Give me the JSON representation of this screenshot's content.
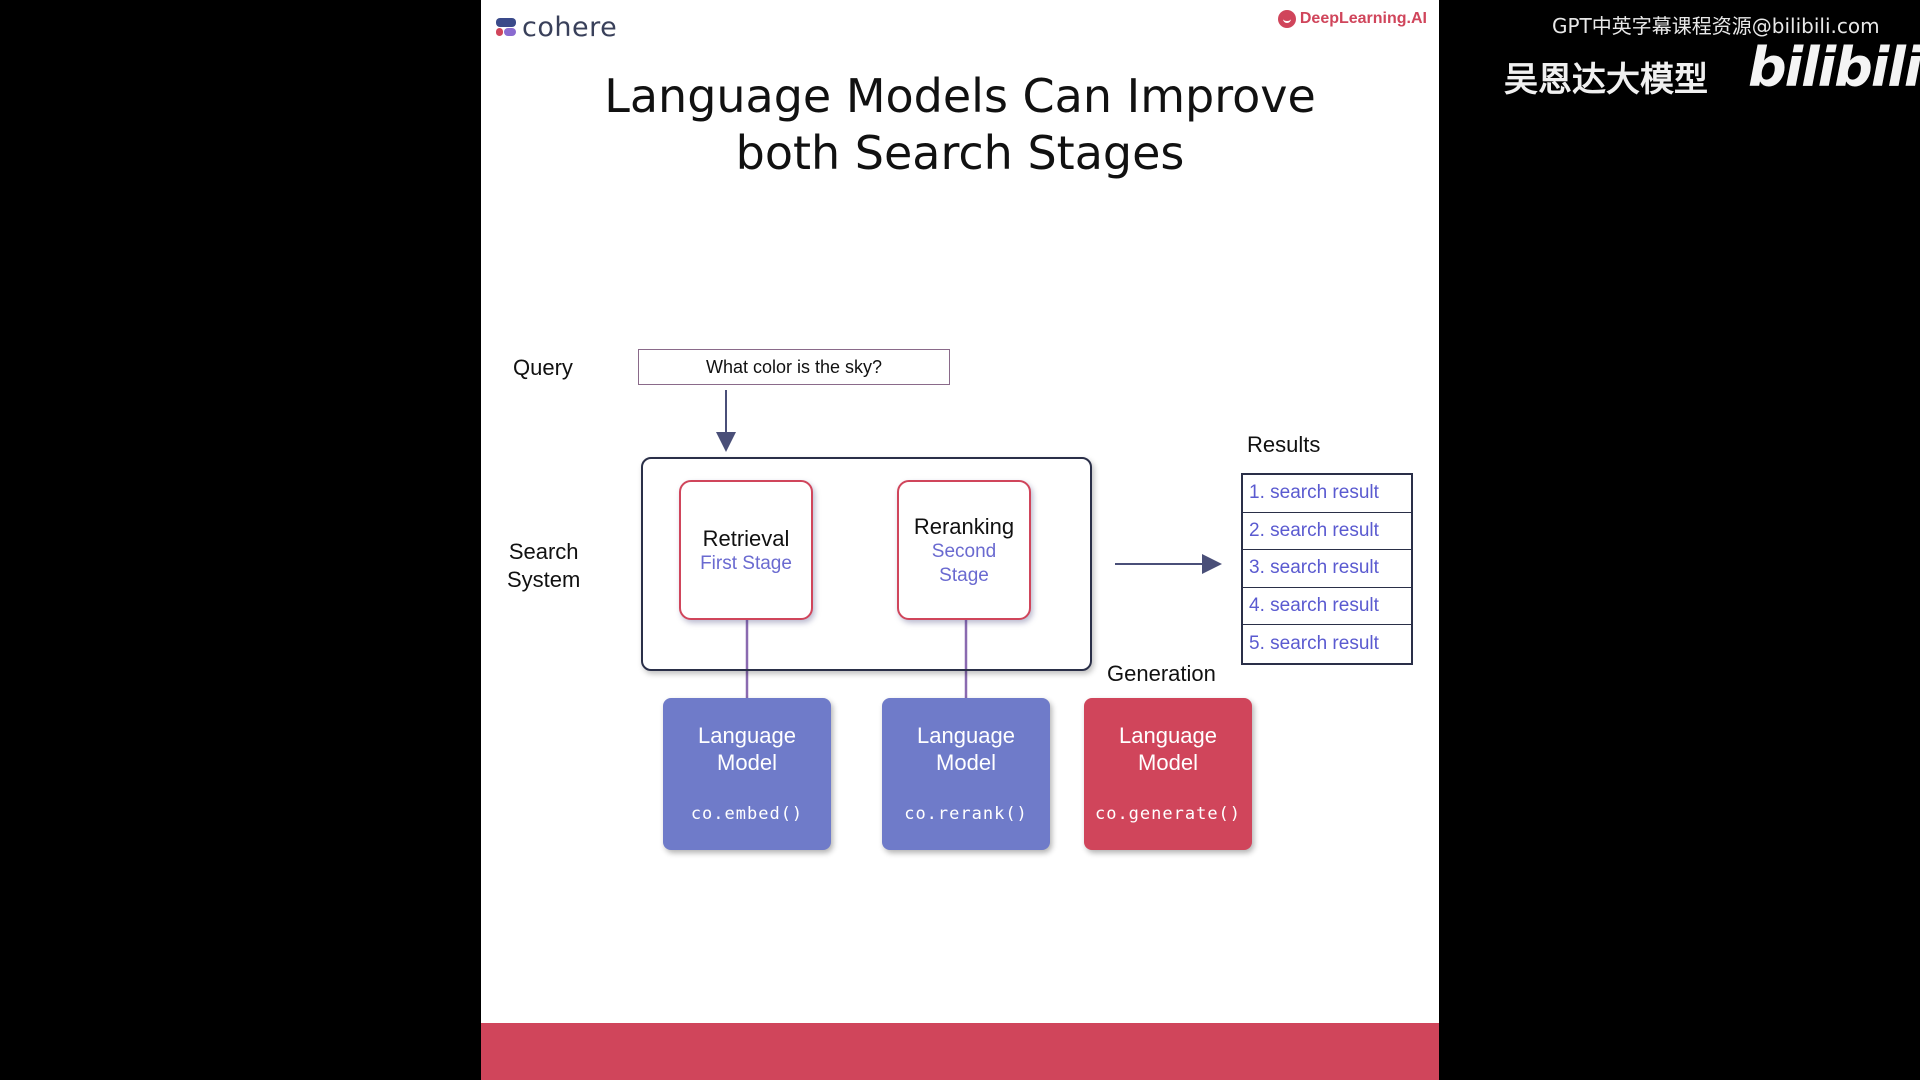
{
  "slide": {
    "brand_left": "cohere",
    "brand_right": "DeepLearning.AI",
    "title_line1": "Language Models Can Improve",
    "title_line2": "both Search Stages"
  },
  "diagram": {
    "query_label": "Query",
    "query_text": "What color is the sky?",
    "search_system_line1": "Search",
    "search_system_line2": "System",
    "retrieval": {
      "name": "Retrieval",
      "stage": "First Stage"
    },
    "reranking": {
      "name": "Reranking",
      "stage_line1": "Second",
      "stage_line2": "Stage"
    },
    "results_label": "Results",
    "results": [
      "1. search result",
      "2. search result",
      "3. search result",
      "4. search result",
      "5. search result"
    ],
    "generation_label": "Generation",
    "models": [
      {
        "line1": "Language",
        "line2": "Model",
        "code": "co.embed()"
      },
      {
        "line1": "Language",
        "line2": "Model",
        "code": "co.rerank()"
      },
      {
        "line1": "Language",
        "line2": "Model",
        "code": "co.generate()"
      }
    ]
  },
  "overlay": {
    "watermark_top": "GPT中英字幕课程资源@bilibili.com",
    "watermark_cn": "吴恩达大模型",
    "watermark_logo": "bilibili"
  },
  "colors": {
    "accent_red": "#d0455b",
    "accent_purple": "#6f7bc9",
    "text_blue": "#5a5ad0"
  }
}
